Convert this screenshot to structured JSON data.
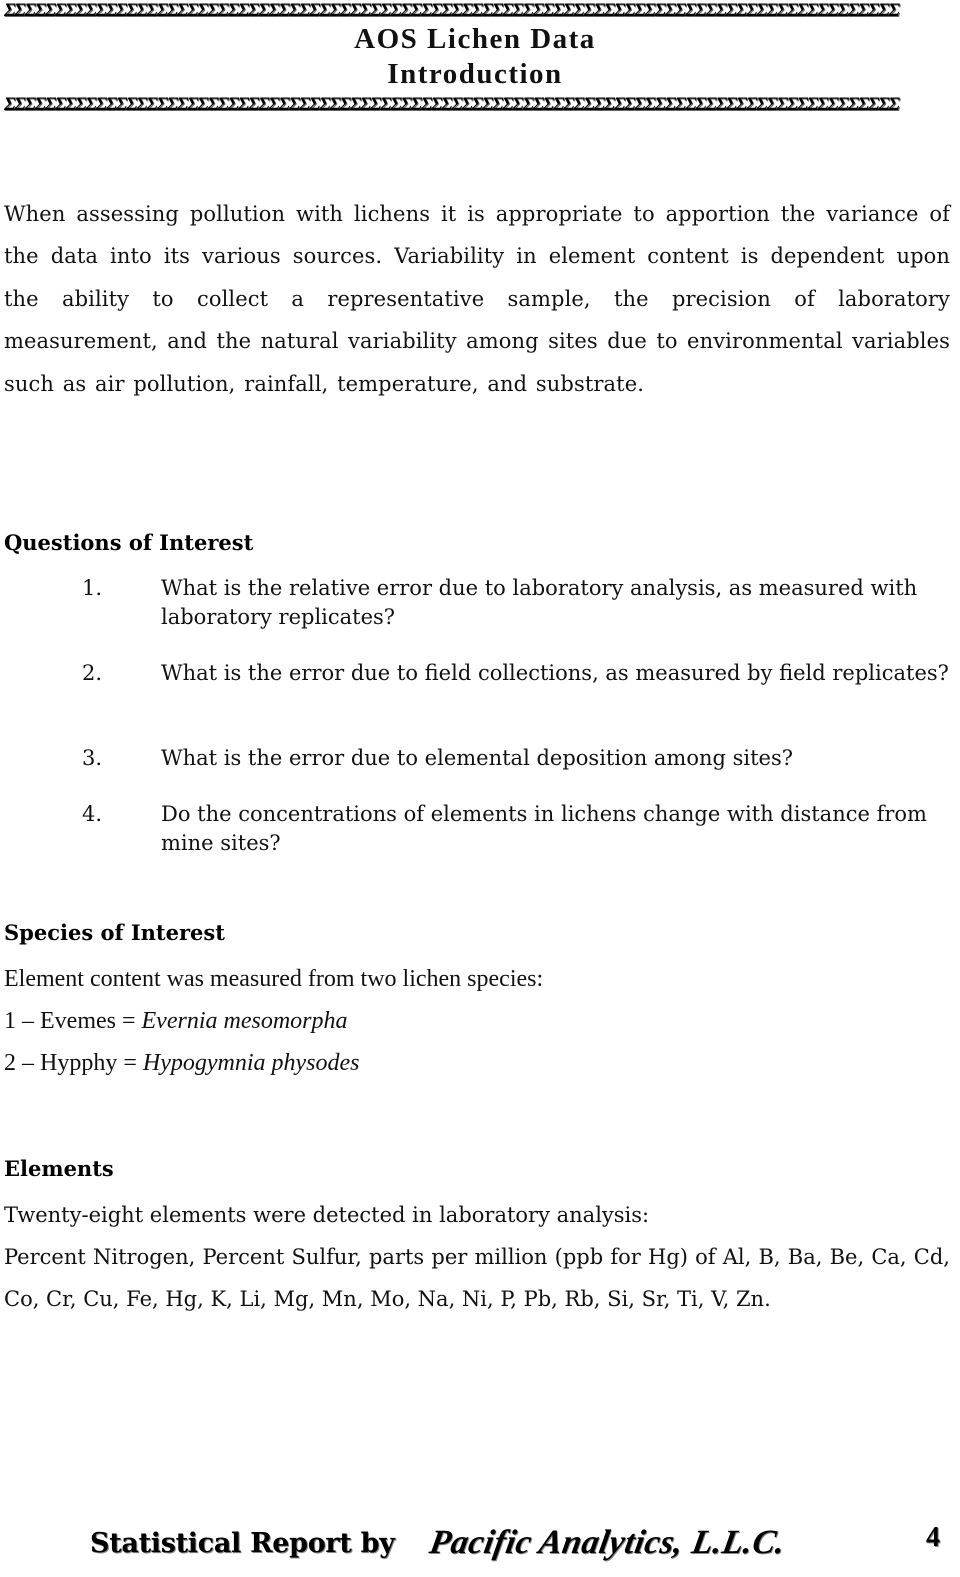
{
  "header": {
    "border_glyph_icon": "sigma-border",
    "border_pattern": "ΣΣΣΣΣΣΣΣΣΣΣΣΣΣΣΣΣΣΣΣΣΣΣΣΣΣΣΣΣΣΣΣΣΣΣΣΣΣΣΣΣΣΣΣΣΣΣΣΣΣΣΣΣΣΣΣΣΣΣΣΣΣΣΣΣΣΣΣΣΣΣΣΣΣΣΣΣΣΣΣΣΣΣΣΣΣΣΣ",
    "title": "AOS Lichen Data",
    "subtitle": "Introduction"
  },
  "intro": {
    "paragraph": "When assessing pollution with lichens it is appropriate to apportion the variance of the data into its various sources. Variability in element content is dependent upon the ability to collect a representative sample, the precision of laboratory measurement, and the natural variability among sites due to environmental variables such as air pollution, rainfall, temperature, and substrate."
  },
  "questions": {
    "heading": "Questions of Interest",
    "items": [
      {
        "number": "1.",
        "text": "What is the relative error due to laboratory analysis, as measured with laboratory replicates?"
      },
      {
        "number": "2.",
        "text": "What is the error due to field collections, as measured by field replicates?"
      },
      {
        "number": "3.",
        "text": "What is the error due to elemental deposition among sites?"
      },
      {
        "number": "4.",
        "text": "Do the concentrations of elements in lichens change with distance from mine sites?"
      }
    ]
  },
  "species": {
    "heading": "Species of Interest",
    "intro": "Element content was measured from two lichen species:",
    "items": [
      {
        "code": "1 – Evemes = ",
        "scientific_name": "Evernia mesomorpha"
      },
      {
        "code": "2 – Hypphy = ",
        "scientific_name": "Hypogymnia physodes"
      }
    ]
  },
  "elements": {
    "heading": "Elements",
    "intro": "Twenty-eight elements were detected in laboratory analysis:",
    "list": "Percent Nitrogen, Percent Sulfur, parts per million (ppb for Hg) of Al, B, Ba, Be, Ca, Cd, Co, Cr, Cu, Fe, Hg, K, Li, Mg, Mn, Mo, Na, Ni, P, Pb, Rb, Si, Sr, Ti, V, Zn."
  },
  "footer": {
    "prefix": "Statistical Report by ",
    "company": "Pacific Analytics, L.L.C.",
    "page_number": "4"
  }
}
